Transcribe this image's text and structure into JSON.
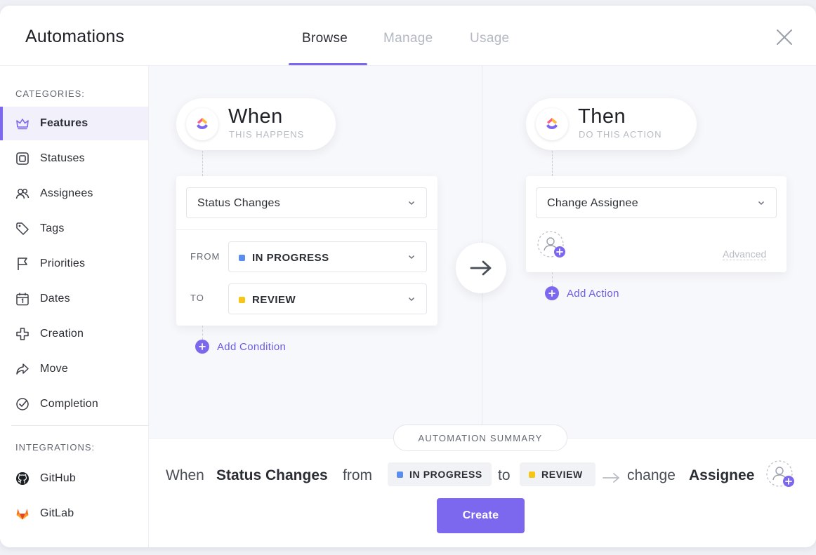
{
  "app_title": "Automations",
  "tabs": [
    {
      "label": "Browse",
      "active": true
    },
    {
      "label": "Manage",
      "active": false
    },
    {
      "label": "Usage",
      "active": false
    }
  ],
  "sidebar": {
    "categories_label": "CATEGORIES:",
    "categories": [
      {
        "label": "Features",
        "icon": "crown-icon",
        "active": true
      },
      {
        "label": "Statuses",
        "icon": "status-square-icon"
      },
      {
        "label": "Assignees",
        "icon": "people-icon"
      },
      {
        "label": "Tags",
        "icon": "tag-icon"
      },
      {
        "label": "Priorities",
        "icon": "flag-icon"
      },
      {
        "label": "Dates",
        "icon": "calendar-icon"
      },
      {
        "label": "Creation",
        "icon": "plus-outline-icon"
      },
      {
        "label": "Move",
        "icon": "share-arrow-icon"
      },
      {
        "label": "Completion",
        "icon": "check-circle-icon"
      }
    ],
    "integrations_label": "INTEGRATIONS:",
    "integrations": [
      {
        "label": "GitHub",
        "icon": "github-icon"
      },
      {
        "label": "GitLab",
        "icon": "gitlab-icon"
      }
    ]
  },
  "trigger": {
    "title": "When",
    "subtitle": "THIS HAPPENS",
    "event": "Status Changes",
    "from_label": "FROM",
    "from_value": "IN PROGRESS",
    "to_label": "TO",
    "to_value": "REVIEW",
    "add_condition": "Add Condition"
  },
  "action": {
    "title": "Then",
    "subtitle": "DO THIS ACTION",
    "type": "Change Assignee",
    "advanced": "Advanced",
    "add_action": "Add Action"
  },
  "summary": {
    "badge": "AUTOMATION SUMMARY",
    "part_when": "When",
    "part_event": "Status Changes",
    "part_from": "from",
    "from_chip": "IN PROGRESS",
    "part_to": "to",
    "to_chip": "REVIEW",
    "part_change": "change",
    "part_target": "Assignee"
  },
  "create_button": "Create",
  "colors": {
    "accent": "#7b68ee",
    "in_progress": "#5b8def",
    "review": "#f5c518",
    "gitlab": "#e24329"
  }
}
